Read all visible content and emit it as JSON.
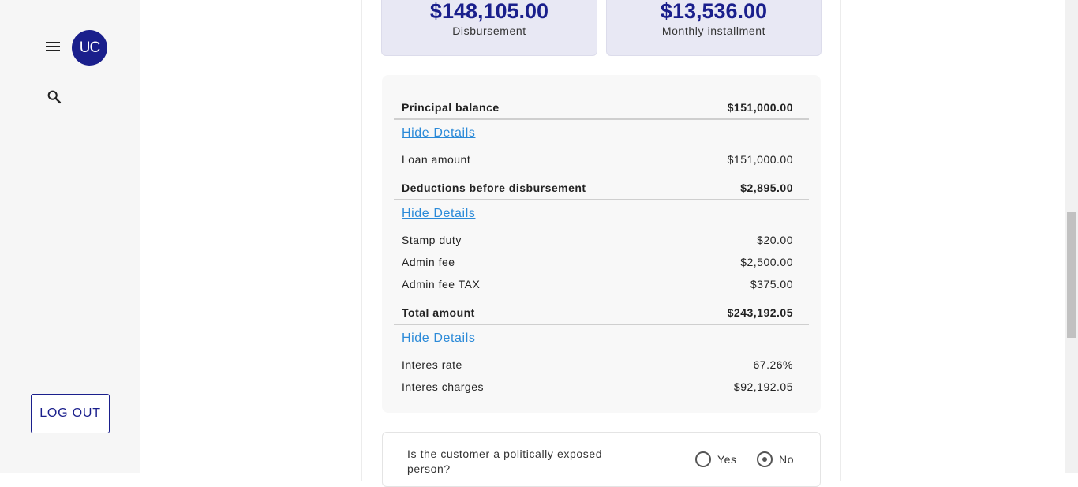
{
  "sidebar": {
    "avatar_initials": "UC",
    "logout_label": "LOG OUT"
  },
  "summary": {
    "disbursement_value": "$148,105.00",
    "disbursement_label": "Disbursement",
    "installment_value": "$13,536.00",
    "installment_label": "Monthly installment"
  },
  "details": {
    "principal": {
      "label": "Principal balance",
      "value": "$151,000.00",
      "toggle": "Hide Details",
      "items": [
        {
          "label": "Loan amount",
          "value": "$151,000.00"
        }
      ]
    },
    "deductions": {
      "label": "Deductions before disbursement",
      "value": "$2,895.00",
      "toggle": "Hide Details",
      "items": [
        {
          "label": "Stamp duty",
          "value": "$20.00"
        },
        {
          "label": "Admin fee",
          "value": "$2,500.00"
        },
        {
          "label": "Admin fee TAX",
          "value": "$375.00"
        }
      ]
    },
    "total": {
      "label": "Total amount",
      "value": "$243,192.05",
      "toggle": "Hide Details",
      "items": [
        {
          "label": "Interes rate",
          "value": "67.26%"
        },
        {
          "label": "Interes charges",
          "value": "$92,192.05"
        }
      ]
    }
  },
  "pep_question": {
    "text": "Is the customer a politically exposed person?",
    "yes_label": "Yes",
    "no_label": "No",
    "selected": "No"
  }
}
